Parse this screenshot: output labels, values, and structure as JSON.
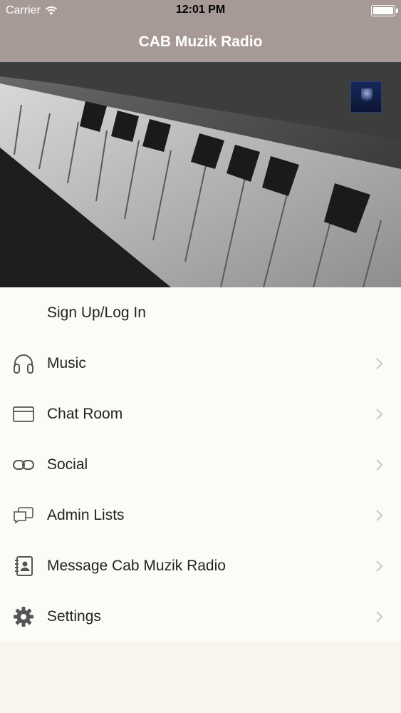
{
  "status_bar": {
    "carrier": "Carrier",
    "time": "12:01 PM",
    "battery_level": 1.0
  },
  "nav": {
    "title": "CAB Muzik Radio"
  },
  "hero": {
    "image": "piano-keys",
    "logo_icon": "station-logo"
  },
  "menu": {
    "items": [
      {
        "label": "Sign Up/Log In",
        "icon": null,
        "chevron": false
      },
      {
        "label": "Music",
        "icon": "headphones-icon",
        "chevron": true
      },
      {
        "label": "Chat Room",
        "icon": "chat-room-icon",
        "chevron": true
      },
      {
        "label": "Social",
        "icon": "link-icon",
        "chevron": true
      },
      {
        "label": "Admin Lists",
        "icon": "chat-bubbles-icon",
        "chevron": true
      },
      {
        "label": "Message Cab Muzik Radio",
        "icon": "contact-book-icon",
        "chevron": true
      },
      {
        "label": "Settings",
        "icon": "gear-icon",
        "chevron": true
      }
    ]
  },
  "colors": {
    "bar": "#a79a96",
    "menu_bg": "#fdfbf7",
    "page_bg": "#f9f5ec",
    "chevron": "#c7c7c7"
  }
}
